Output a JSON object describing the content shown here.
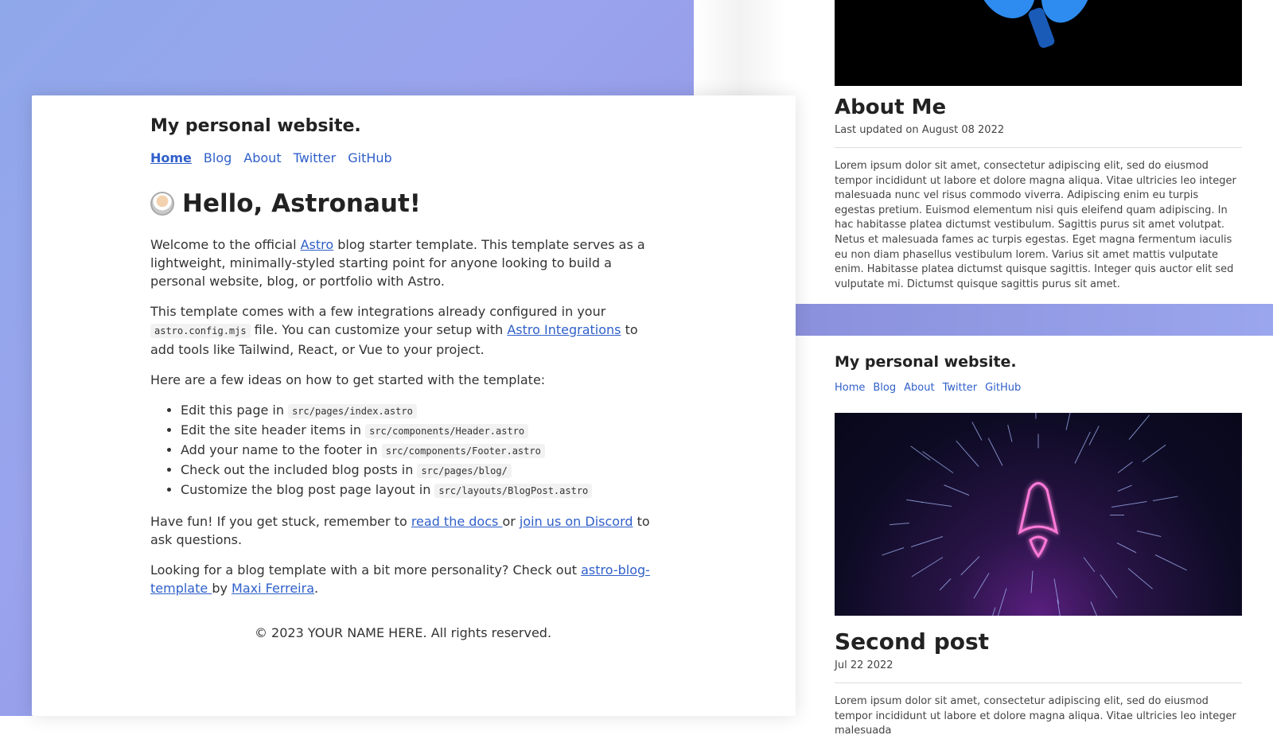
{
  "main": {
    "site_title": "My personal website.",
    "nav": [
      "Home",
      "Blog",
      "About",
      "Twitter",
      "GitHub"
    ],
    "hero_title": "Hello, Astronaut!",
    "p1": {
      "before": "Welcome to the official ",
      "link": "Astro",
      "after": " blog starter template. This template serves as a lightweight, minimally-styled starting point for anyone looking to build a personal website, blog, or portfolio with Astro."
    },
    "p2": {
      "before": "This template comes with a few integrations already configured in your ",
      "code": "astro.config.mjs",
      "mid": " file. You can customize your setup with ",
      "link": "Astro Integrations",
      "after": " to add tools like Tailwind, React, or Vue to your project."
    },
    "p3": "Here are a few ideas on how to get started with the template:",
    "ideas": [
      {
        "text": "Edit this page in ",
        "code": "src/pages/index.astro"
      },
      {
        "text": "Edit the site header items in ",
        "code": "src/components/Header.astro"
      },
      {
        "text": "Add your name to the footer in ",
        "code": "src/components/Footer.astro"
      },
      {
        "text": "Check out the included blog posts in ",
        "code": "src/pages/blog/"
      },
      {
        "text": "Customize the blog post page layout in ",
        "code": "src/layouts/BlogPost.astro"
      }
    ],
    "p4": {
      "before": "Have fun! If you get stuck, remember to ",
      "link1": "read the docs ",
      "mid": "or ",
      "link2": "join us on Discord",
      "after": " to ask questions."
    },
    "p5": {
      "before": "Looking for a blog template with a bit more personality? Check out ",
      "link1": "astro-blog-template ",
      "mid": "by ",
      "link2": "Maxi Ferreira",
      "after": "."
    },
    "footer": "© 2023 YOUR NAME HERE. All rights reserved."
  },
  "about": {
    "title": "About Me",
    "updated": "Last updated on August 08 2022",
    "body": "Lorem ipsum dolor sit amet, consectetur adipiscing elit, sed do eiusmod tempor incididunt ut labore et dolore magna aliqua. Vitae ultricies leo integer malesuada nunc vel risus commodo viverra. Adipiscing enim eu turpis egestas pretium. Euismod elementum nisi quis eleifend quam adipiscing. In hac habitasse platea dictumst vestibulum. Sagittis purus sit amet volutpat. Netus et malesuada fames ac turpis egestas. Eget magna fermentum iaculis eu non diam phasellus vestibulum lorem. Varius sit amet mattis vulputate enim. Habitasse platea dictumst quisque sagittis. Integer quis auctor elit sed vulputate mi. Dictumst quisque sagittis purus sit amet."
  },
  "post": {
    "site_title": "My personal website.",
    "nav": [
      "Home",
      "Blog",
      "About",
      "Twitter",
      "GitHub"
    ],
    "title": "Second post",
    "date": "Jul 22 2022",
    "body": "Lorem ipsum dolor sit amet, consectetur adipiscing elit, sed do eiusmod tempor incididunt ut labore et dolore magna aliqua. Vitae ultricies leo integer malesuada"
  },
  "colors": {
    "accent_link": "#2f5fc9",
    "background_gradient": "#8fa8ea"
  }
}
